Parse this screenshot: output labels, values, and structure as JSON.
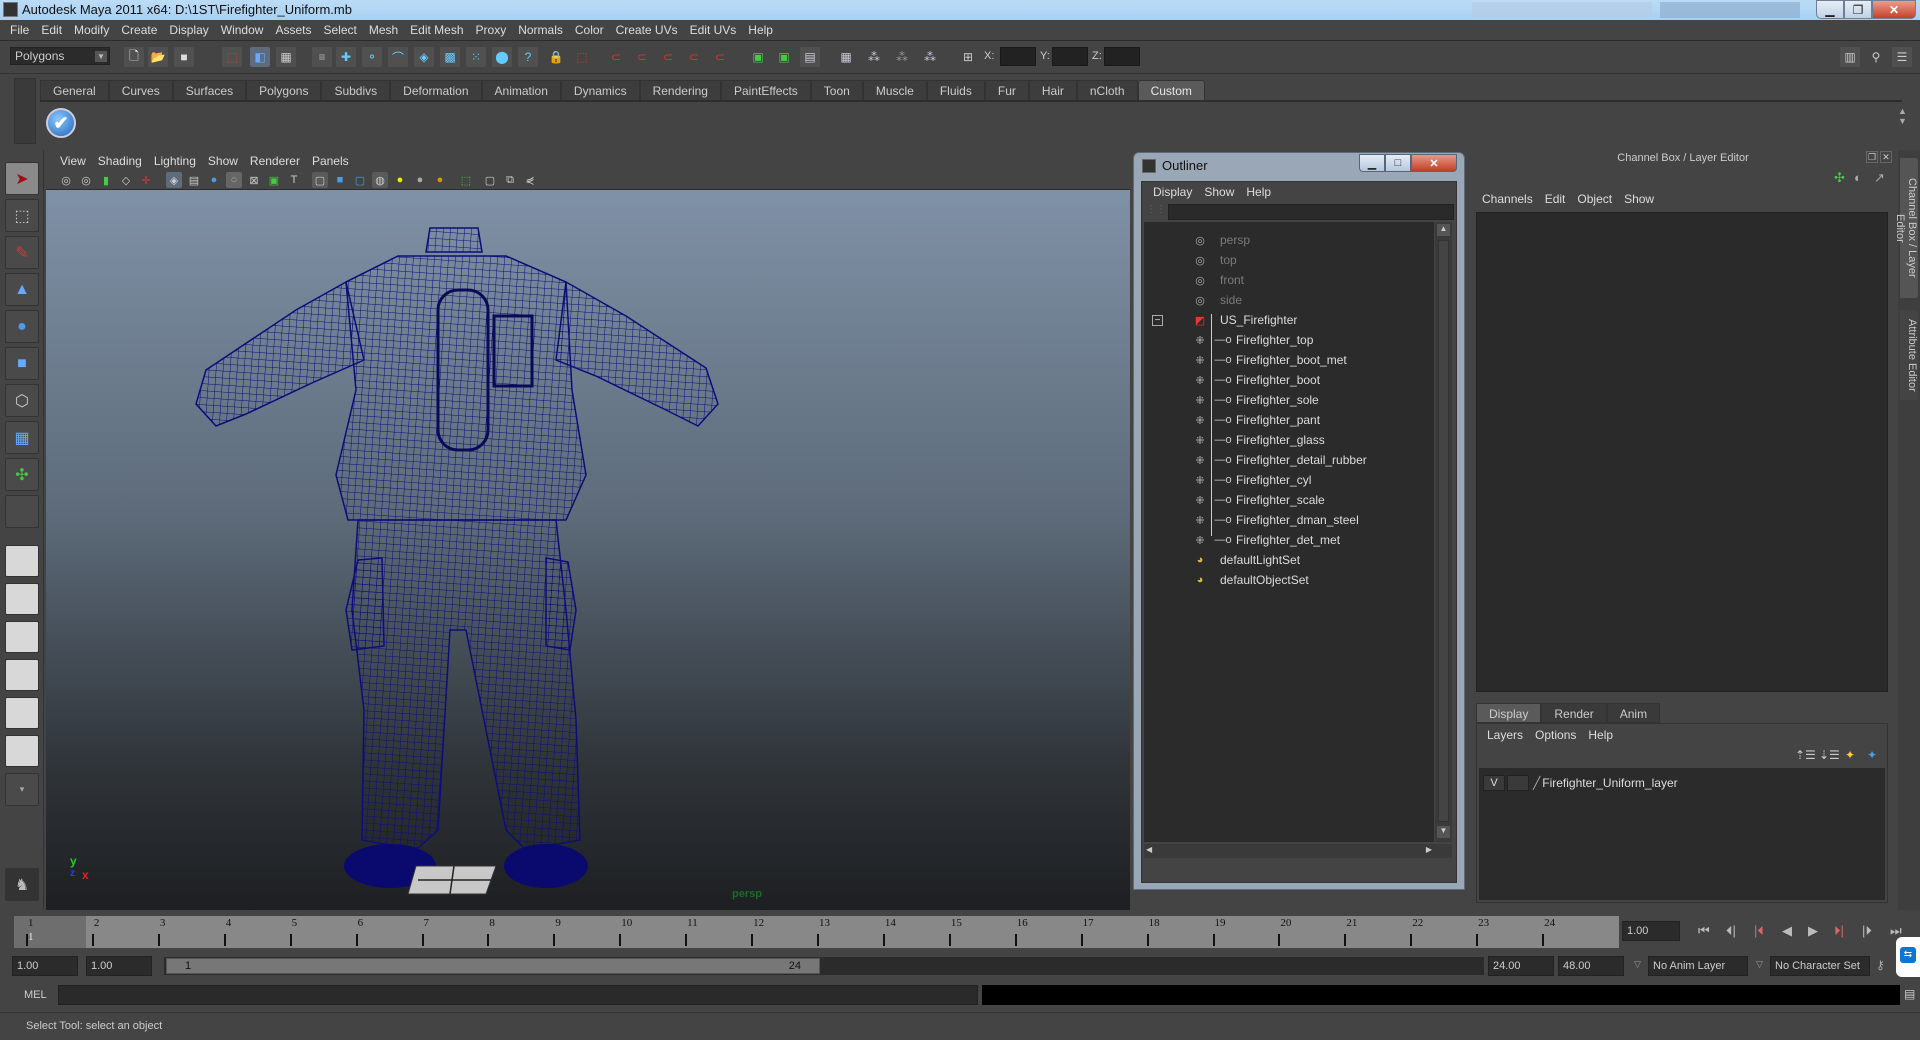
{
  "window": {
    "title": "Autodesk Maya 2011 x64: D:\\1ST\\Firefighter_Uniform.mb",
    "controls": [
      "minimize",
      "restore",
      "close"
    ]
  },
  "menubar": [
    "File",
    "Edit",
    "Modify",
    "Create",
    "Display",
    "Window",
    "Assets",
    "Select",
    "Mesh",
    "Edit Mesh",
    "Proxy",
    "Normals",
    "Color",
    "Create UVs",
    "Edit UVs",
    "Help"
  ],
  "statusline": {
    "mode": "Polygons",
    "x_label": "X:",
    "y_label": "Y:",
    "z_label": "Z:",
    "x_value": "",
    "y_value": "",
    "z_value": ""
  },
  "shelf": {
    "tabs": [
      "General",
      "Curves",
      "Surfaces",
      "Polygons",
      "Subdivs",
      "Deformation",
      "Animation",
      "Dynamics",
      "Rendering",
      "PaintEffects",
      "Toon",
      "Muscle",
      "Fluids",
      "Fur",
      "Hair",
      "nCloth",
      "Custom"
    ],
    "active_tab": "Custom",
    "icons": [
      "checkmark-icon"
    ]
  },
  "toolbox": {
    "tools": [
      "select-tool",
      "lasso-tool",
      "paint-select-tool",
      "move-tool",
      "rotate-tool",
      "scale-tool",
      "universal-manipulator",
      "soft-mod-tool",
      "show-manipulator",
      "last-tool"
    ],
    "layouts": [
      "single-perspective",
      "four-view",
      "outliner-perspective",
      "perspective-graph",
      "hypershade-perspective",
      "graph-hypergraph"
    ]
  },
  "viewport": {
    "menu": [
      "View",
      "Shading",
      "Lighting",
      "Show",
      "Renderer",
      "Panels"
    ],
    "camera_label": "persp",
    "axis": {
      "x": "x",
      "y": "y",
      "z": "z"
    },
    "wire_color": "#0d0d7a"
  },
  "outliner": {
    "title": "Outliner",
    "menu": [
      "Display",
      "Show",
      "Help"
    ],
    "filter_value": "",
    "items": [
      {
        "name": "persp",
        "type": "camera",
        "depth": 0
      },
      {
        "name": "top",
        "type": "camera",
        "depth": 0
      },
      {
        "name": "front",
        "type": "camera",
        "depth": 0
      },
      {
        "name": "side",
        "type": "camera",
        "depth": 0
      },
      {
        "name": "US_Firefighter",
        "type": "group",
        "depth": 0,
        "expanded": true
      },
      {
        "name": "Firefighter_top",
        "type": "mesh",
        "depth": 1
      },
      {
        "name": "Firefighter_boot_met",
        "type": "mesh",
        "depth": 1
      },
      {
        "name": "Firefighter_boot",
        "type": "mesh",
        "depth": 1
      },
      {
        "name": "Firefighter_sole",
        "type": "mesh",
        "depth": 1
      },
      {
        "name": "Firefighter_pant",
        "type": "mesh",
        "depth": 1
      },
      {
        "name": "Firefighter_glass",
        "type": "mesh",
        "depth": 1
      },
      {
        "name": "Firefighter_detail_rubber",
        "type": "mesh",
        "depth": 1
      },
      {
        "name": "Firefighter_cyl",
        "type": "mesh",
        "depth": 1
      },
      {
        "name": "Firefighter_scale",
        "type": "mesh",
        "depth": 1
      },
      {
        "name": "Firefighter_dman_steel",
        "type": "mesh",
        "depth": 1
      },
      {
        "name": "Firefighter_det_met",
        "type": "mesh",
        "depth": 1
      },
      {
        "name": "defaultLightSet",
        "type": "set",
        "depth": 0
      },
      {
        "name": "defaultObjectSet",
        "type": "set",
        "depth": 0
      }
    ]
  },
  "channelbox": {
    "title": "Channel Box / Layer Editor",
    "menu": [
      "Channels",
      "Edit",
      "Object",
      "Show"
    ],
    "side_tabs": [
      "Channel Box / Layer Editor",
      "Attribute Editor"
    ]
  },
  "layereditor": {
    "tabs": [
      "Display",
      "Render",
      "Anim"
    ],
    "active_tab": "Display",
    "menu": [
      "Layers",
      "Options",
      "Help"
    ],
    "layers": [
      {
        "visible": "V",
        "playback": "",
        "name": "Firefighter_Uniform_layer"
      }
    ]
  },
  "timeslider": {
    "ticks": [
      "1",
      "2",
      "3",
      "4",
      "5",
      "6",
      "7",
      "8",
      "9",
      "10",
      "11",
      "12",
      "13",
      "14",
      "15",
      "16",
      "17",
      "18",
      "19",
      "20",
      "21",
      "22",
      "23",
      "24"
    ],
    "current_frame_marker": "1",
    "current_frame": "1.00",
    "playback_buttons": [
      "go-to-start",
      "step-back-key",
      "step-back-frame",
      "play-backward",
      "play-forward",
      "step-forward-frame",
      "step-forward-key",
      "go-to-end"
    ]
  },
  "rangeslider": {
    "start_time": "1.00",
    "playback_start": "1.00",
    "range_start_label": "1",
    "range_end_label": "24",
    "playback_end": "24.00",
    "end_time": "48.00",
    "anim_layer": "No Anim Layer",
    "character_set": "No Character Set"
  },
  "cmdline": {
    "label": "MEL",
    "value": "",
    "output": ""
  },
  "helpline": {
    "text": "Select Tool: select an object"
  }
}
